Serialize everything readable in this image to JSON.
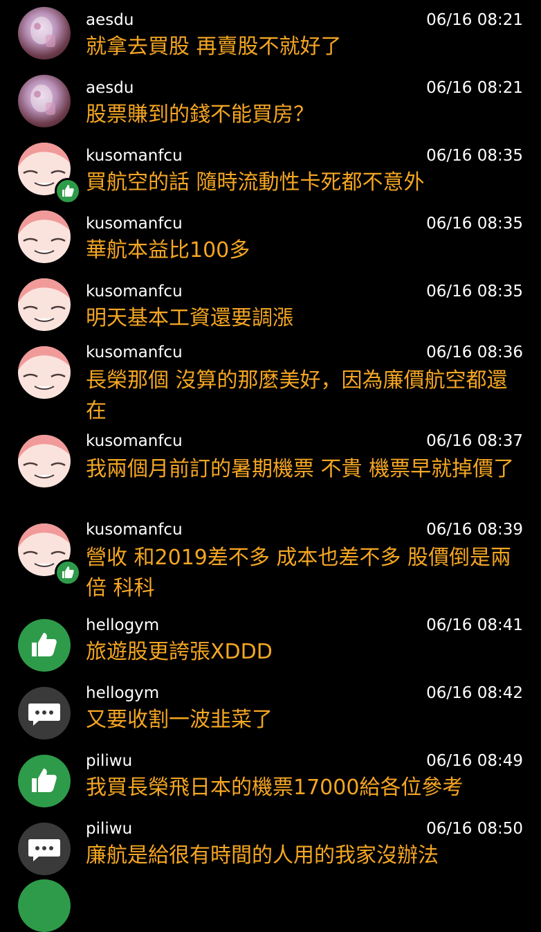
{
  "colors": {
    "background": "#000000",
    "name_text": "#ffffff",
    "message_text": "#f5a623",
    "like_green": "#2e9b4a",
    "comment_gray": "#3a3a3a"
  },
  "comments": [
    {
      "user": "aesdu",
      "time": "06/16 08:21",
      "text": "就拿去買股 再賣股不就好了",
      "avatar": "photo-avatar"
    },
    {
      "user": "aesdu",
      "time": "06/16 08:21",
      "text": "股票賺到的錢不能買房？",
      "avatar": "photo-avatar"
    },
    {
      "user": "kusomanfcu",
      "time": "06/16 08:35",
      "text": "買航空的話 隨時流動性卡死都不意外",
      "avatar": "cartoon-face-avatar",
      "badge": "thumbs-up-badge-icon"
    },
    {
      "user": "kusomanfcu",
      "time": "06/16 08:35",
      "text": "華航本益比100多",
      "avatar": "cartoon-face-avatar"
    },
    {
      "user": "kusomanfcu",
      "time": "06/16 08:35",
      "text": "明天基本工資還要調漲",
      "avatar": "cartoon-face-avatar"
    },
    {
      "user": "kusomanfcu",
      "time": "06/16 08:36",
      "text": "長榮那個 沒算的那麼美好，因為廉價航空都還在",
      "avatar": "cartoon-face-avatar"
    },
    {
      "user": "kusomanfcu",
      "time": "06/16 08:37",
      "text": "我兩個月前訂的暑期機票 不貴 機票早就掉價了",
      "avatar": "cartoon-face-avatar"
    },
    {
      "user": "kusomanfcu",
      "time": "06/16 08:39",
      "text": "營收 和2019差不多 成本也差不多 股價倒是兩倍 科科",
      "avatar": "cartoon-face-avatar",
      "badge": "thumbs-up-badge-icon"
    },
    {
      "user": "hellogym",
      "time": "06/16 08:41",
      "text": "旅遊股更誇張XDDD",
      "avatar": "thumbs-up-icon"
    },
    {
      "user": "hellogym",
      "time": "06/16 08:42",
      "text": "又要收割一波韭菜了",
      "avatar": "comment-bubble-icon"
    },
    {
      "user": "piliwu",
      "time": "06/16 08:49",
      "text": "我買長榮飛日本的機票17000給各位參考",
      "avatar": "thumbs-up-icon"
    },
    {
      "user": "piliwu",
      "time": "06/16 08:50",
      "text": "廉航是給很有時間的人用的我家沒辦法",
      "avatar": "comment-bubble-icon"
    }
  ]
}
